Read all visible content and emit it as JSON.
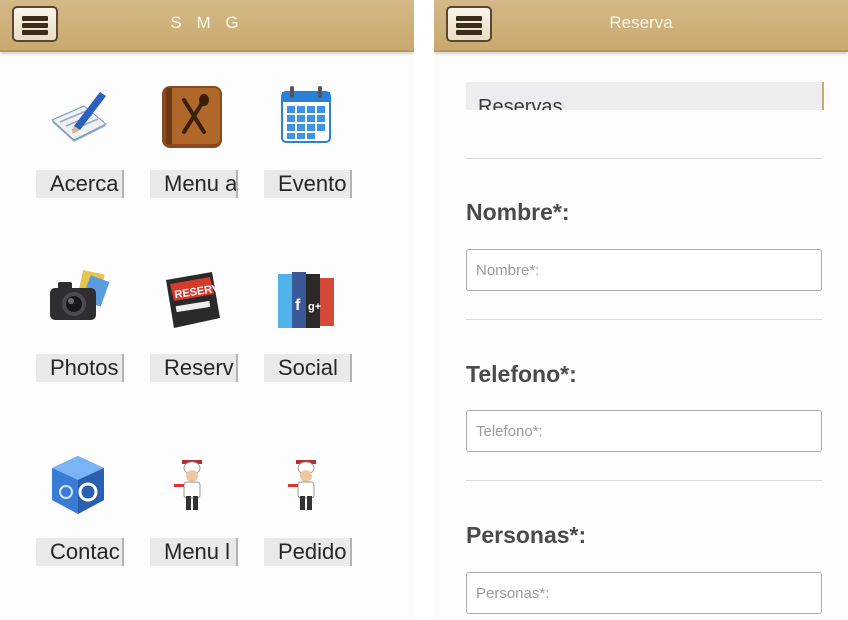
{
  "left_screen": {
    "title": "S M G",
    "tiles": [
      {
        "label": "Acerca",
        "icon": "notepad-pen-icon"
      },
      {
        "label": "Menu a",
        "icon": "cookbook-icon"
      },
      {
        "label": "Evento",
        "icon": "calendar-icon"
      },
      {
        "label": "Photos",
        "icon": "camera-photos-icon"
      },
      {
        "label": "Reserv",
        "icon": "reservation-sign-icon"
      },
      {
        "label": "Social",
        "icon": "social-books-icon"
      },
      {
        "label": "Contac",
        "icon": "contact-cube-icon"
      },
      {
        "label": "Menu l",
        "icon": "chef-waiter-icon"
      },
      {
        "label": "Pedido",
        "icon": "chef-waiter-icon"
      }
    ]
  },
  "right_screen": {
    "title": "Reserva",
    "select": {
      "value": "Reservas"
    },
    "fields": [
      {
        "label": "Nombre*:",
        "placeholder": "Nombre*:"
      },
      {
        "label": "Telefono*:",
        "placeholder": "Telefono*:"
      },
      {
        "label": "Personas*:",
        "placeholder": "Personas*:"
      }
    ]
  },
  "colors": {
    "header": "#c9a96e",
    "header_text": "#fbf6ec",
    "label_text": "#4a4a4e"
  }
}
